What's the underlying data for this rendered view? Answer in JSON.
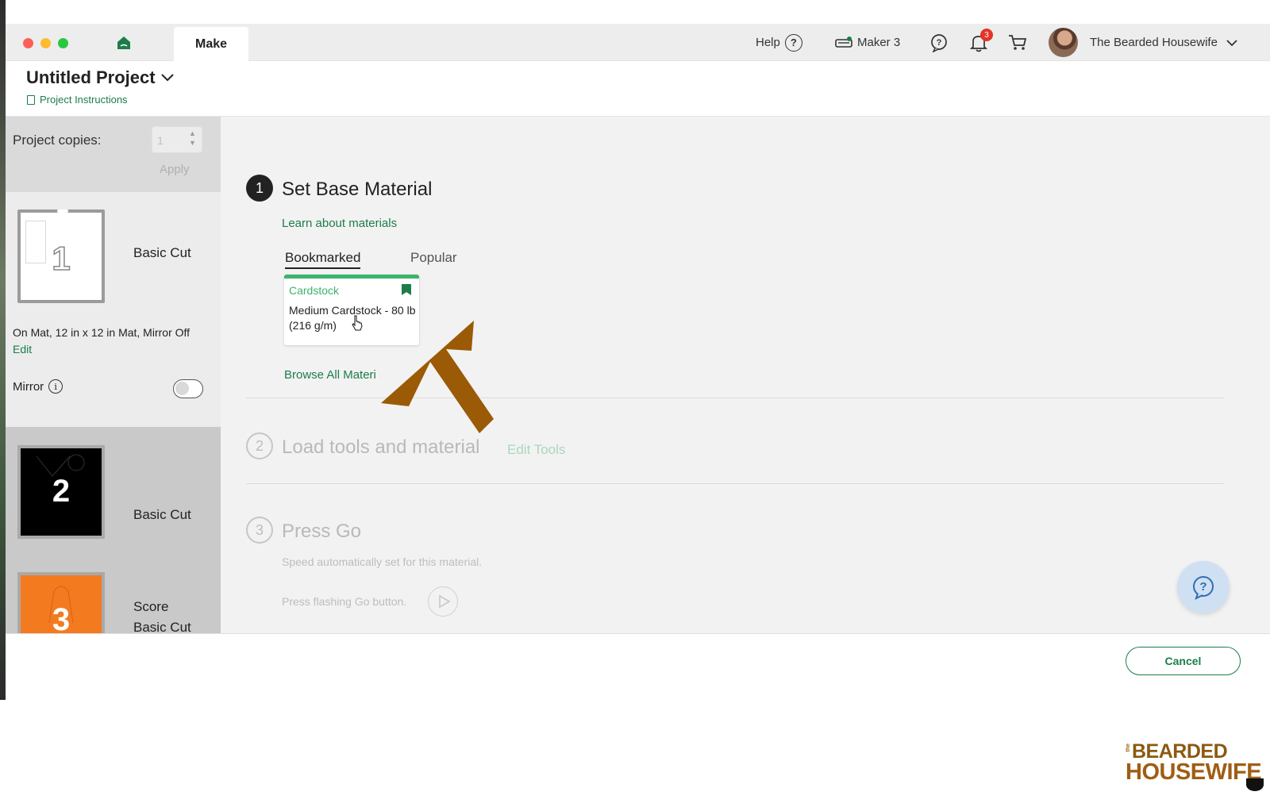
{
  "window": {
    "active_tab": "Make",
    "help_label": "Help",
    "help_glyph": "?",
    "machine_label": "Maker 3",
    "notification_count": "3",
    "user_name": "The Bearded Housewife"
  },
  "header": {
    "project_title": "Untitled Project",
    "instructions_link": "Project Instructions"
  },
  "sidebar": {
    "copies_label": "Project copies:",
    "copies_value": "1",
    "apply_label": "Apply",
    "mats": [
      {
        "number": "1",
        "name": "Basic Cut",
        "description": "On Mat, 12 in x 12 in Mat, Mirror Off",
        "edit_label": "Edit"
      },
      {
        "number": "2",
        "name": "Basic Cut"
      },
      {
        "number": "3",
        "name_line1": "Score",
        "name_line2": "Basic Cut"
      }
    ],
    "mirror_label": "Mirror",
    "mirror_info_glyph": "i",
    "mirror_on": false
  },
  "main": {
    "step1": {
      "number": "1",
      "title": "Set Base Material",
      "learn_link": "Learn about materials",
      "tabs": [
        "Bookmarked",
        "Popular"
      ],
      "active_tab": "Bookmarked",
      "material": {
        "category": "Cardstock",
        "name": "Medium Cardstock - 80 lb (216 g/m)"
      },
      "browse_link": "Browse All Materi"
    },
    "step2": {
      "number": "2",
      "title": "Load tools and material",
      "edit_tools": "Edit Tools"
    },
    "step3": {
      "number": "3",
      "title": "Press Go",
      "speed_text": "Speed automatically set for this material.",
      "press_text": "Press flashing Go button."
    }
  },
  "footer": {
    "cancel_label": "Cancel"
  },
  "watermark": {
    "the": "the",
    "line1": "BEARDED",
    "line2": "HOUSEWIFE"
  },
  "colors": {
    "accent_green": "#1c7d4a",
    "tile_green": "#3cb36b",
    "arrow_brown": "#9b5a05",
    "badge_red": "#e5332a"
  }
}
